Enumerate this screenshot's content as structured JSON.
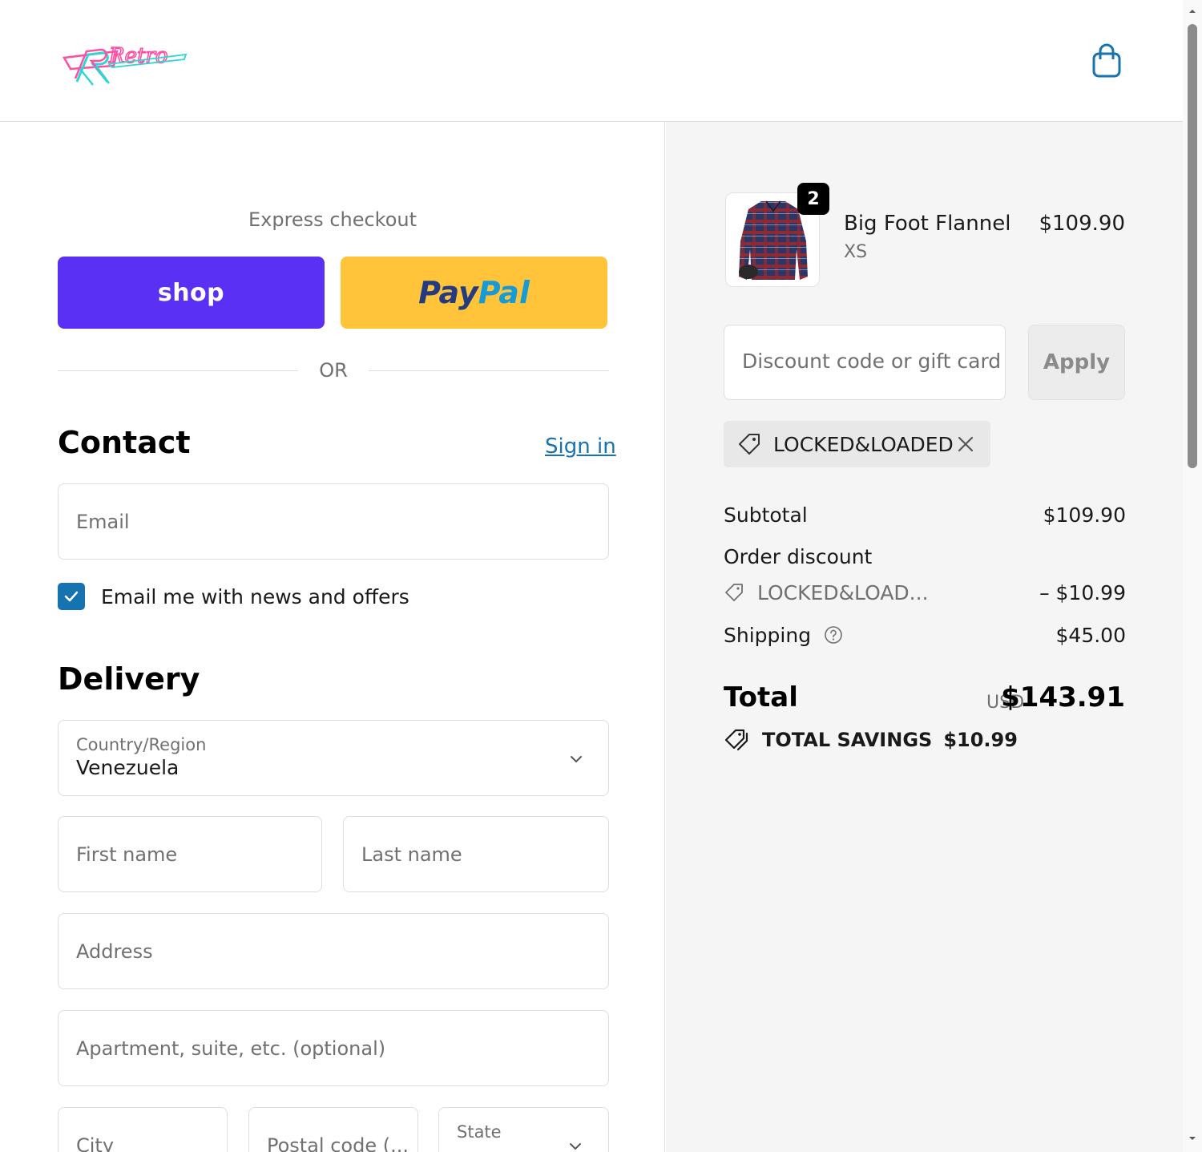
{
  "header": {
    "logo_text": "Retro",
    "cart_icon": "shopping-bag-icon"
  },
  "express": {
    "title": "Express checkout",
    "shop_label": "shop",
    "paypal_label_part1": "Pay",
    "paypal_label_part2": "Pal",
    "or_label": "OR"
  },
  "contact": {
    "title": "Contact",
    "signin_label": "Sign in",
    "email_placeholder": "Email",
    "newsletter_label": "Email me with news and offers",
    "newsletter_checked": true
  },
  "delivery": {
    "title": "Delivery",
    "country_label": "Country/Region",
    "country_value": "Venezuela",
    "first_name_placeholder": "First name",
    "last_name_placeholder": "Last name",
    "address_placeholder": "Address",
    "apartment_placeholder": "Apartment, suite, etc. (optional)",
    "city_placeholder": "City",
    "postal_placeholder": "Postal code (...",
    "state_label": "State"
  },
  "order": {
    "item": {
      "name": "Big Foot Flannel",
      "variant": "XS",
      "price": "$109.90",
      "quantity": "2"
    },
    "discount_placeholder": "Discount code or gift card",
    "apply_label": "Apply",
    "applied_code": "LOCKED&LOADED",
    "subtotal_label": "Subtotal",
    "subtotal_value": "$109.90",
    "order_discount_label": "Order discount",
    "discount_code_short": "LOCKED&LOAD...",
    "discount_value": "– $10.99",
    "shipping_label": "Shipping",
    "shipping_value": "$45.00",
    "total_label": "Total",
    "total_currency": "USD",
    "total_value": "$143.91",
    "savings_label": "TOTAL SAVINGS",
    "savings_value": "$10.99"
  },
  "colors": {
    "shop_purple": "#5a31f4",
    "paypal_yellow": "#ffc439",
    "link_blue": "#1773b0",
    "checkbox_blue": "#1773b0"
  }
}
